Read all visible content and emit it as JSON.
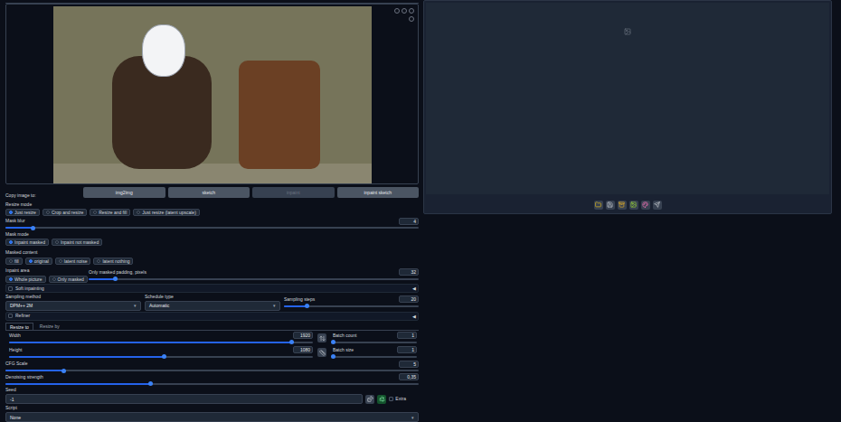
{
  "copy_image": {
    "label": "Copy image to:",
    "buttons": [
      {
        "label": "img2img",
        "disabled": false
      },
      {
        "label": "sketch",
        "disabled": false
      },
      {
        "label": "inpaint",
        "disabled": true
      },
      {
        "label": "inpaint sketch",
        "disabled": false
      }
    ]
  },
  "resize_mode": {
    "label": "Resize mode",
    "options": [
      {
        "label": "Just resize",
        "selected": true
      },
      {
        "label": "Crop and resize",
        "selected": false
      },
      {
        "label": "Resize and fill",
        "selected": false
      },
      {
        "label": "Just resize (latent upscale)",
        "selected": false
      }
    ]
  },
  "mask_blur": {
    "label": "Mask blur",
    "value": "4",
    "level": 0.066
  },
  "mask_mode": {
    "label": "Mask mode",
    "options": [
      {
        "label": "Inpaint masked",
        "selected": true
      },
      {
        "label": "Inpaint not masked",
        "selected": false
      }
    ]
  },
  "masked_content": {
    "label": "Masked content",
    "options": [
      {
        "label": "fill",
        "selected": false
      },
      {
        "label": "original",
        "selected": true
      },
      {
        "label": "latent noise",
        "selected": false
      },
      {
        "label": "latent nothing",
        "selected": false
      }
    ]
  },
  "inpaint_area": {
    "label": "Inpaint area",
    "options": [
      {
        "label": "Whole picture",
        "selected": true
      },
      {
        "label": "Only masked",
        "selected": false
      }
    ]
  },
  "only_masked_padding": {
    "label": "Only masked padding, pixels",
    "value": "32",
    "level": 0.08
  },
  "soft_inpainting": {
    "label": "Soft inpainting",
    "checked": false,
    "toggle": "◀"
  },
  "sampling_method": {
    "label": "Sampling method",
    "value": "DPM++ 2M",
    "arrow": "▾"
  },
  "schedule_type": {
    "label": "Schedule type",
    "value": "Automatic",
    "arrow": "▾"
  },
  "sampling_steps": {
    "label": "Sampling steps",
    "value": "20",
    "level": 0.17
  },
  "refiner": {
    "label": "Refiner",
    "checked": false,
    "toggle": "◀"
  },
  "size_tabs": [
    {
      "label": "Resize to",
      "selected": true
    },
    {
      "label": "Resize by",
      "selected": false
    }
  ],
  "width": {
    "label": "Width",
    "value": "1920",
    "level": 0.93
  },
  "height": {
    "label": "Height",
    "value": "1080",
    "level": 0.51
  },
  "batch_count": {
    "label": "Batch count",
    "value": "1",
    "level": 0.0
  },
  "batch_size": {
    "label": "Batch size",
    "value": "1",
    "level": 0.0
  },
  "cfg_scale": {
    "label": "CFG Scale",
    "value": "5",
    "level": 0.14
  },
  "denoising_strength": {
    "label": "Denoising strength",
    "value": "0,35",
    "level": 0.35
  },
  "seed": {
    "label": "Seed",
    "value": "-1",
    "extra": {
      "label": "Extra",
      "checked": false
    }
  },
  "script": {
    "label": "Script",
    "value": "None",
    "arrow": "▾"
  }
}
